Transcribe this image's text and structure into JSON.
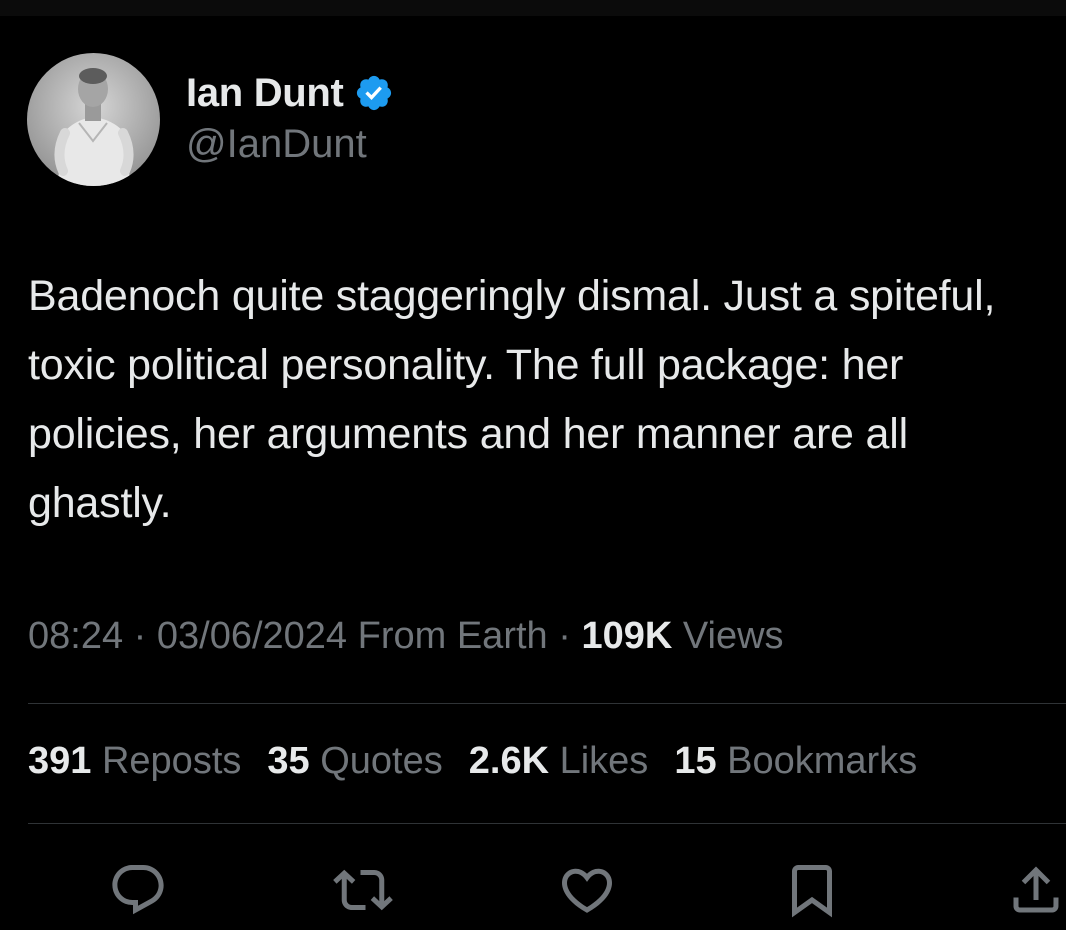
{
  "author": {
    "display_name": "Ian Dunt",
    "handle": "@IanDunt",
    "avatar_icon": "profile-photo",
    "verified_icon": "verified-badge-icon"
  },
  "tweet": {
    "text": "Badenoch quite staggeringly dismal. Just a spiteful, toxic political personality. The full package: her policies, her arguments and her manner are all ghastly."
  },
  "meta": {
    "time": "08:24",
    "separator": " · ",
    "date": "03/06/2024",
    "source": "From Earth",
    "views_count": "109K",
    "views_label": "Views"
  },
  "stats": {
    "reposts_count": "391",
    "reposts_label": "Reposts",
    "quotes_count": "35",
    "quotes_label": "Quotes",
    "likes_count": "2.6K",
    "likes_label": "Likes",
    "bookmarks_count": "15",
    "bookmarks_label": "Bookmarks"
  },
  "actions": [
    "reply-icon",
    "repost-icon",
    "like-icon",
    "bookmark-icon",
    "share-icon"
  ],
  "colors": {
    "background": "#000000",
    "text_primary": "#e7e9ea",
    "text_secondary": "#71767b",
    "divider": "#2f3336",
    "verified_blue": "#1d9bf0"
  }
}
